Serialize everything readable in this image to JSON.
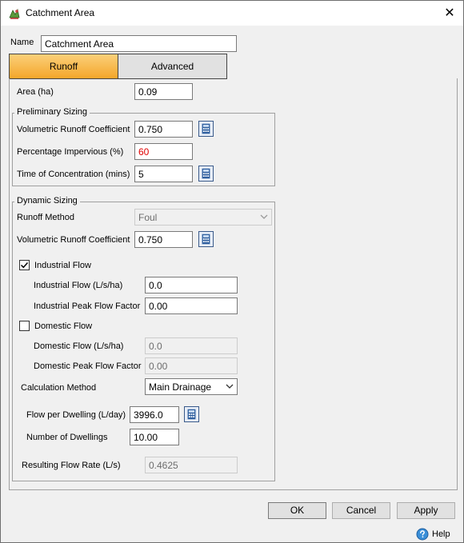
{
  "window": {
    "title": "Catchment Area",
    "close_glyph": "✕"
  },
  "name_field": {
    "label": "Name",
    "value": "Catchment Area"
  },
  "tabs": [
    {
      "label": "Runoff",
      "active": true
    },
    {
      "label": "Advanced",
      "active": false
    }
  ],
  "area": {
    "label": "Area (ha)",
    "value": "0.09"
  },
  "preliminary": {
    "title": "Preliminary Sizing",
    "vrc": {
      "label": "Volumetric Runoff Coefficient",
      "value": "0.750"
    },
    "impervious": {
      "label": "Percentage Impervious (%)",
      "value": "60"
    },
    "toc": {
      "label": "Time of Concentration (mins)",
      "value": "5"
    }
  },
  "dynamic": {
    "title": "Dynamic Sizing",
    "runoff_method": {
      "label": "Runoff Method",
      "value": "Foul"
    },
    "vrc": {
      "label": "Volumetric Runoff Coefficient",
      "value": "0.750"
    },
    "industrial": {
      "checkbox_label": "Industrial Flow",
      "checked": true,
      "flow": {
        "label": "Industrial Flow (L/s/ha)",
        "value": "0.0"
      },
      "peak": {
        "label": "Industrial Peak Flow Factor",
        "value": "0.00"
      }
    },
    "domestic": {
      "checkbox_label": "Domestic Flow",
      "checked": false,
      "flow": {
        "label": "Domestic Flow (L/s/ha)",
        "value": "0.0"
      },
      "peak": {
        "label": "Domestic Peak Flow Factor",
        "value": "0.00"
      }
    },
    "calc_method": {
      "label": "Calculation Method",
      "value": "Main Drainage"
    },
    "flow_per_dwelling": {
      "label": "Flow per Dwelling (L/day)",
      "value": "3996.0"
    },
    "num_dwellings": {
      "label": "Number of Dwellings",
      "value": "10.00"
    },
    "resulting": {
      "label": "Resulting Flow Rate (L/s)",
      "value": "0.4625"
    }
  },
  "buttons": {
    "ok": "OK",
    "cancel": "Cancel",
    "apply": "Apply"
  },
  "help": {
    "label": "Help"
  },
  "colors": {
    "tab_active": "#f4a62a",
    "invalid_text": "#e00000",
    "calc_icon": "#2f5f9f"
  }
}
